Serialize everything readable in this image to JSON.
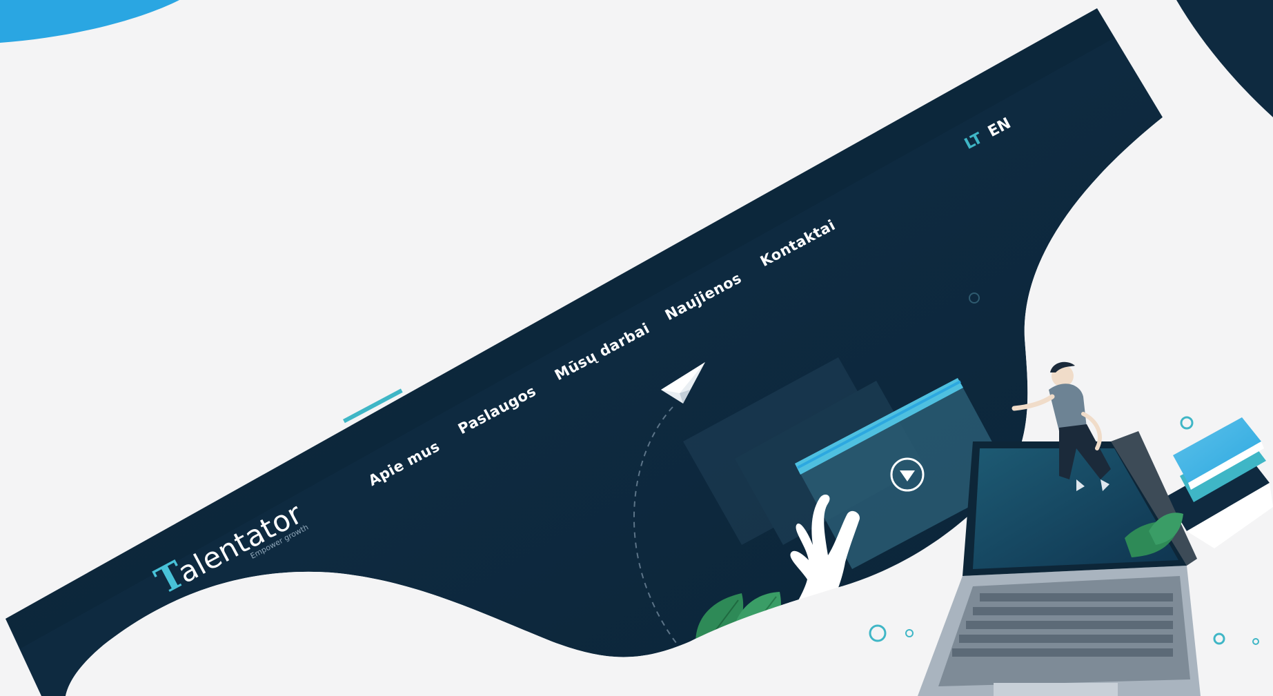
{
  "brand": {
    "name": "alentator",
    "mark": "T",
    "tagline": "Empower growth"
  },
  "nav": {
    "items": [
      {
        "label": "Apie mus",
        "active": true
      },
      {
        "label": "Paslaugos",
        "active": false
      },
      {
        "label": "Mūsų darbai",
        "active": false
      },
      {
        "label": "Naujienos",
        "active": false
      },
      {
        "label": "Kontaktai",
        "active": false
      }
    ]
  },
  "language": {
    "options": [
      "LT",
      "EN"
    ],
    "selected": "LT"
  },
  "colors": {
    "page_background": "#f4f4f5",
    "hero_navy": "#0f2a40",
    "accent_teal": "#3fb6c6",
    "accent_blue": "#2da8e0",
    "leaf_green": "#2e8a57"
  },
  "hero": {
    "video_button_icon": "play-down-triangle-icon",
    "illustration": [
      "paper-plane-icon",
      "laptop-icon",
      "books-icon",
      "person-sitting-icon",
      "hand-icon",
      "leaves-icon"
    ]
  }
}
